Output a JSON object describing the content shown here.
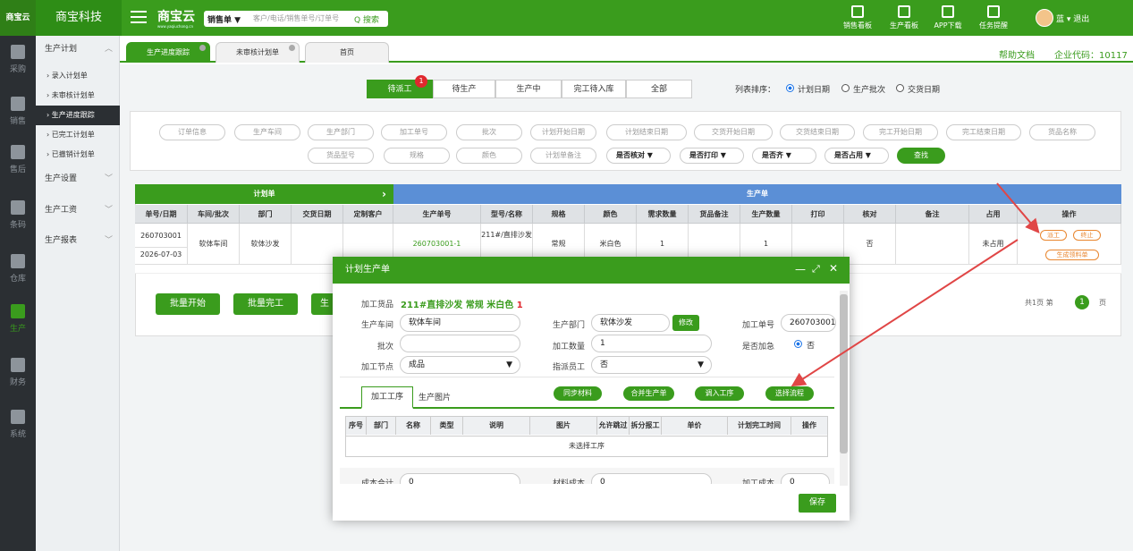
{
  "app": {
    "logo": "商宝云",
    "company": "商宝科技",
    "brand": "商宝云",
    "brand_sub": "www.yaqiuchong.cn"
  },
  "search": {
    "select": "销售单 ▼",
    "placeholder": "客户/电话/销售单号/订单号",
    "button": "Q 搜索"
  },
  "topnav": [
    {
      "label": "销售看板",
      "icon": "chart-icon"
    },
    {
      "label": "生产看板",
      "icon": "chart-icon"
    },
    {
      "label": "APP下载",
      "icon": "qr-icon"
    },
    {
      "label": "任务提醒",
      "icon": "flag-icon"
    }
  ],
  "user": {
    "name": "蓝 ▾",
    "logout": "退出"
  },
  "leftnav": [
    {
      "label": "采购",
      "icon": "cart-icon"
    },
    {
      "label": "销售",
      "icon": "grid-icon"
    },
    {
      "label": "售后",
      "icon": "grid-icon"
    },
    {
      "label": "条码",
      "icon": "barcode-icon"
    },
    {
      "label": "仓库",
      "icon": "warehouse-icon"
    },
    {
      "label": "生产",
      "icon": "robot-icon"
    },
    {
      "label": "财务",
      "icon": "calculator-icon"
    },
    {
      "label": "系统",
      "icon": "gear-icon"
    }
  ],
  "submenu": {
    "group1": "生产计划",
    "items": [
      "› 录入计划单",
      "› 未审核计划单",
      "› 生产进度跟踪",
      "› 已完工计划单",
      "› 已撤销计划单"
    ],
    "group2": "生产设置",
    "group3": "生产工资",
    "group4": "生产报表"
  },
  "tabs": [
    "生产进度跟踪",
    "未审核计划单",
    "首页"
  ],
  "help": "帮助文档",
  "company_code": "企业代码：10117",
  "status_tabs": [
    "待派工",
    "待生产",
    "生产中",
    "完工待入库",
    "全部"
  ],
  "badge": "1",
  "sort": {
    "label": "列表排序：",
    "options": [
      "计划日期",
      "生产批次",
      "交货日期"
    ]
  },
  "filters_row1": [
    "订单信息",
    "生产车间",
    "生产部门",
    "加工单号",
    "批次",
    "计划开始日期",
    "计划结束日期",
    "交货开始日期",
    "交货结束日期",
    "完工开始日期",
    "完工结束日期",
    "货品名称"
  ],
  "filters_row2": [
    "货品型号",
    "规格",
    "颜色",
    "计划单备注"
  ],
  "dropdowns": [
    "是否核对 ▼",
    "是否打印 ▼",
    "是否齐 ▼",
    "是否占用 ▼"
  ],
  "find": "查找",
  "table": {
    "group1": "计划单",
    "group2": "生产单",
    "headers": [
      "单号/日期",
      "车间/批次",
      "部门",
      "交货日期",
      "定制客户",
      "生产单号",
      "型号/名称",
      "规格",
      "颜色",
      "需求数量",
      "货品备注",
      "生产数量",
      "打印",
      "核对",
      "备注",
      "占用",
      "操作"
    ],
    "row": {
      "order_no": "260703001",
      "date": "2026-07-03",
      "workshop": "软体车间",
      "dept": "软体沙发",
      "prod_no": "260703001-1",
      "model": "211#/直排沙发",
      "spec": "常规",
      "color": "米白色",
      "need_qty": "1",
      "prod_qty": "1",
      "check": "否",
      "occupy": "未占用"
    },
    "ops": [
      "派工",
      "终止",
      "生成领料单"
    ]
  },
  "buttons": [
    "批量开始",
    "批量完工",
    "生"
  ],
  "pager": {
    "text": "共1页 第",
    "page": "1",
    "suffix": "页"
  },
  "modal": {
    "title": "计划生产单",
    "goods_label": "加工货品",
    "goods_value": "211#直排沙发 常规 米白色",
    "goods_qty": "1",
    "workshop_label": "生产车间",
    "workshop": "软体车间",
    "dept_label": "生产部门",
    "dept": "软体沙发",
    "modify": "修改",
    "procno_label": "加工单号",
    "procno": "260703001-",
    "batch_label": "批次",
    "batch": "",
    "qty_label": "加工数量",
    "qty": "1",
    "urgent_label": "是否加急",
    "urgent": "否",
    "node_label": "加工节点",
    "node": "成品",
    "assign_label": "指派员工",
    "assign": "否",
    "subtabs": [
      "加工工序",
      "生产图片"
    ],
    "actions": [
      "同步材料",
      "合并生产单",
      "调入工序",
      "选择流程"
    ],
    "grid_headers": [
      "序号",
      "部门",
      "名称",
      "类型",
      "说明",
      "图片",
      "允许跳过",
      "拆分报工",
      "单价",
      "计划完工时间",
      "操作"
    ],
    "empty": "未选择工序",
    "cost_label": "成本合计",
    "cost": "0",
    "mat_label": "材料成本",
    "mat": "0",
    "proc_label": "加工成本",
    "proc": "0",
    "save": "保存"
  },
  "colors": {
    "primary": "#3a9c1d",
    "blue": "#5b8fd6",
    "arrow": "#e04646"
  }
}
